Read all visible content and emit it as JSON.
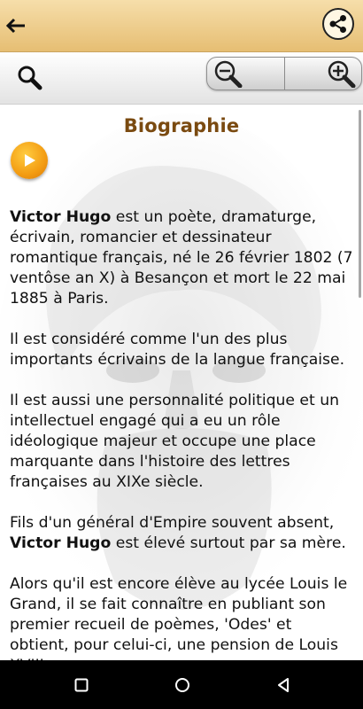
{
  "header": {
    "back_icon": "arrow-left-icon",
    "share_icon": "share-icon"
  },
  "toolbar": {
    "search_icon": "magnifier-icon",
    "zoom_out_icon": "zoom-out-icon",
    "zoom_in_icon": "zoom-in-icon"
  },
  "content": {
    "title": "Biographie",
    "play_icon": "play-icon",
    "paragraphs": [
      {
        "bold": "Victor Hugo",
        "text": " est un poète, dramaturge, écrivain, romancier et dessinateur romantique français, né le 26 février 1802 (7 ventôse an X) à Besançon et mort le 22 mai 1885 à Paris."
      },
      {
        "text": "Il est considéré comme l'un des plus importants écrivains de la langue française."
      },
      {
        "text": "Il est aussi une personnalité politique et un intellectuel engagé qui a eu un rôle idéologique majeur et occupe une place marquante dans l'histoire des lettres françaises au XIXe siècle."
      },
      {
        "text_before": "Fils d'un général d'Empire souvent absent, ",
        "bold": "Victor Hugo",
        "text": " est élevé surtout par sa mère."
      },
      {
        "text": "Alors qu'il est encore élève au lycée Louis le Grand, il se fait connaître en publiant son premier recueil de poèmes, 'Odes' et obtient, pour celui-ci, une pension de Louis XVIII."
      }
    ]
  },
  "navbar": {
    "recents_icon": "square-icon",
    "home_icon": "circle-icon",
    "back_icon": "triangle-back-icon"
  },
  "colors": {
    "header_bg": "#ecc782",
    "title_color": "#7a4a10",
    "play_button": "#f39c12"
  }
}
